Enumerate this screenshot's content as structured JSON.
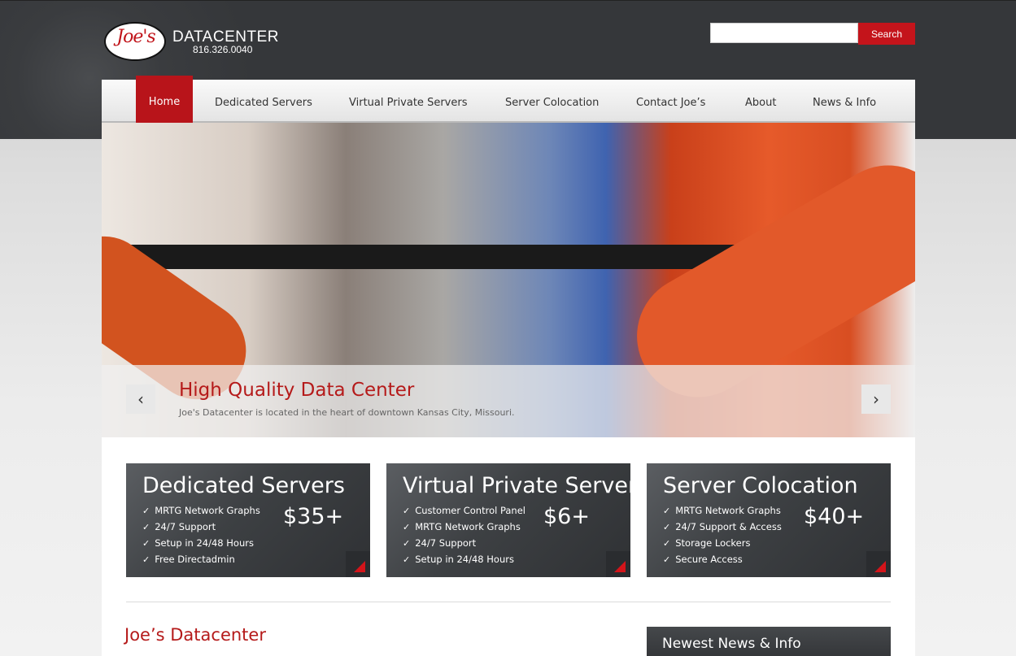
{
  "header": {
    "logo_script": "Joe's",
    "logo_name": "DATACENTER",
    "phone": "816.326.0040",
    "search": {
      "placeholder": "",
      "value": "",
      "button_label": "Search"
    }
  },
  "nav": {
    "items": [
      {
        "label": "Home",
        "active": true
      },
      {
        "label": "Dedicated Servers"
      },
      {
        "label": "Virtual Private Servers"
      },
      {
        "label": "Server Colocation"
      },
      {
        "label": "Contact Joe’s"
      },
      {
        "label": "About"
      },
      {
        "label": "News & Info"
      }
    ]
  },
  "slider": {
    "title": "High Quality Data Center",
    "text": "Joe's Datacenter is located in the heart of downtown Kansas City, Missouri.",
    "prev_icon": "‹",
    "next_icon": "›"
  },
  "offers": [
    {
      "title": "Dedicated Servers",
      "features": [
        "MRTG Network Graphs",
        "24/7 Support",
        "Setup in 24/48 Hours",
        "Free Directadmin"
      ],
      "price": "$35+"
    },
    {
      "title": "Virtual Private Servers",
      "features": [
        "Customer Control Panel",
        "MRTG Network Graphs",
        "24/7 Support",
        "Setup in 24/48 Hours"
      ],
      "price": "$6+"
    },
    {
      "title": "Server Colocation",
      "features": [
        "MRTG Network Graphs",
        "24/7 Support & Access",
        "Storage Lockers",
        "Secure Access"
      ],
      "price": "$40+"
    }
  ],
  "check_glyph": "✓",
  "main": {
    "section_title": "Joe’s Datacenter",
    "news_title": "Newest News & Info"
  },
  "colors": {
    "accent": "#c4141b",
    "header_bg": "#38393c",
    "box_bg": "#3d4043"
  }
}
